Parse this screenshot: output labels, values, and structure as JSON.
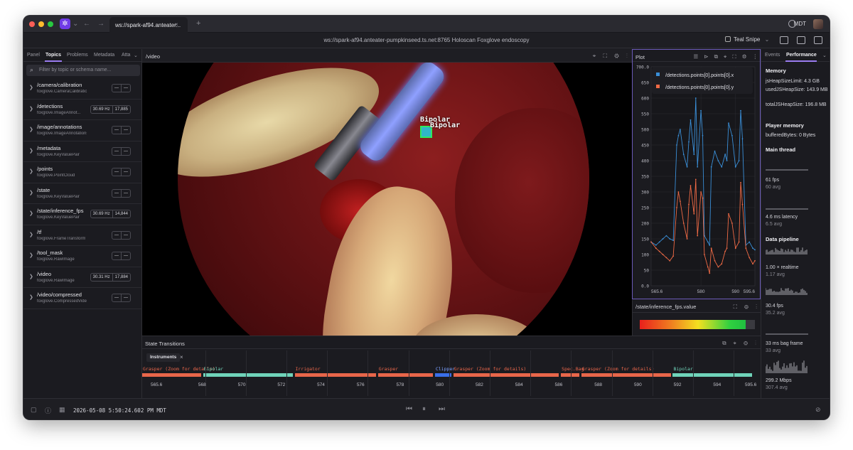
{
  "app": {
    "logo_glyph": "✲",
    "tab_title": "ws://spark-af94.anteater...",
    "tab_close": "×",
    "tab_add": "+",
    "timezone": "MDT",
    "back": "←",
    "forward": "→",
    "chevron": "⌄"
  },
  "toolbar": {
    "connection": "ws://spark-af94.anteater-pumpkinseed.ts.net:8765 Holoscan Foxglove endoscopy",
    "layout_name": "Teal Snipe",
    "layout_chevron": "⌄"
  },
  "left_panel": {
    "tabs": [
      "Panel",
      "Topics",
      "Problems",
      "Metadata",
      "Atta"
    ],
    "active_tab": "Topics",
    "search_placeholder": "Filter by topic or schema name...",
    "search_icon": "⌕",
    "topics": [
      {
        "name": "/camera/calibration",
        "schema": "foxglove.CameraCalibration",
        "hz": "—",
        "count": "—"
      },
      {
        "name": "/detections",
        "schema": "foxglove.ImageAnnot...",
        "hz": "30.69 Hz",
        "count": "17,885"
      },
      {
        "name": "/image/annotations",
        "schema": "foxglove.ImageAnnotations",
        "hz": "—",
        "count": "—"
      },
      {
        "name": "/metadata",
        "schema": "foxglove.KeyValuePair",
        "hz": "—",
        "count": "—"
      },
      {
        "name": "/points",
        "schema": "foxglove.PointCloud",
        "hz": "—",
        "count": "—"
      },
      {
        "name": "/state",
        "schema": "foxglove.KeyValuePair",
        "hz": "—",
        "count": "—"
      },
      {
        "name": "/state/inference_fps",
        "schema": "foxglove.KeyValuePair",
        "hz": "30.69 Hz",
        "count": "14,844"
      },
      {
        "name": "/tf",
        "schema": "foxglove.FrameTransform",
        "hz": "—",
        "count": "—"
      },
      {
        "name": "/tool_mask",
        "schema": "foxglove.RawImage",
        "hz": "—",
        "count": "—"
      },
      {
        "name": "/video",
        "schema": "foxglove.RawImage",
        "hz": "30.31 Hz",
        "count": "17,884"
      },
      {
        "name": "/video/compressed",
        "schema": "foxglove.CompressedVideo",
        "hz": "—",
        "count": "—"
      }
    ]
  },
  "video_panel": {
    "title": "/video",
    "detections": [
      "Bipolar",
      "Bipolar"
    ],
    "icons": "⌖ ⛶ ⚙ ⋮"
  },
  "plot_panel": {
    "title": "Plot",
    "icons": "☰ ⊳ ⧉ ⌖ ⛶ ⚙ ⋮",
    "legend": [
      {
        "label": "/detections.points[0].points[0].x",
        "color": "#3a8fd8"
      },
      {
        "label": "/detections.points[0].points[0].y",
        "color": "#ef6a45"
      }
    ]
  },
  "chart_data": {
    "type": "line",
    "title": "",
    "xlabel": "",
    "ylabel": "",
    "xlim": [
      565.6,
      595.6
    ],
    "ylim": [
      0,
      700
    ],
    "x_ticks": [
      "565.6",
      "580",
      "590",
      "595.6"
    ],
    "y_ticks": [
      "0.0",
      "50",
      "100",
      "150",
      "200",
      "250",
      "300",
      "350",
      "400",
      "450",
      "500",
      "550",
      "600",
      "650",
      "700.0"
    ],
    "grid": true,
    "legend_position": "top",
    "series": [
      {
        "name": "/detections.points[0].points[0].x",
        "color": "#3a8fd8",
        "x": [
          565.6,
          567,
          568,
          569,
          570,
          571,
          572,
          573,
          573.5,
          574,
          575,
          576,
          576.5,
          577,
          578,
          578.5,
          579,
          580,
          580.5,
          581,
          582,
          582.5,
          583,
          584,
          585,
          586,
          587,
          587.5,
          588,
          589,
          590,
          591,
          591.5,
          592,
          593,
          594,
          595,
          595.6
        ],
        "values": [
          140,
          130,
          140,
          150,
          160,
          150,
          145,
          450,
          480,
          500,
          420,
          380,
          460,
          530,
          420,
          600,
          380,
          560,
          480,
          160,
          140,
          130,
          380,
          430,
          400,
          380,
          420,
          400,
          520,
          480,
          380,
          400,
          560,
          470,
          130,
          140,
          120,
          115
        ]
      },
      {
        "name": "/detections.points[0].points[0].y",
        "color": "#ef6a45",
        "x": [
          565.6,
          567,
          568,
          569,
          570,
          571,
          572,
          573,
          573.5,
          574,
          575,
          576,
          576.5,
          577,
          578,
          578.5,
          579,
          580,
          580.5,
          581,
          582,
          582.5,
          583,
          584,
          585,
          586,
          587,
          587.5,
          588,
          589,
          590,
          591,
          591.5,
          592,
          593,
          594,
          595,
          595.6
        ],
        "values": [
          140,
          120,
          110,
          100,
          90,
          80,
          95,
          250,
          300,
          270,
          200,
          150,
          260,
          320,
          230,
          340,
          160,
          300,
          280,
          100,
          60,
          40,
          120,
          80,
          60,
          70,
          110,
          120,
          230,
          200,
          120,
          140,
          330,
          260,
          120,
          90,
          70,
          80
        ]
      }
    ]
  },
  "gauge_panel": {
    "title": "/state/inference_fps.value",
    "value": 0.92,
    "icons": "⛶ ⚙ ⋮"
  },
  "right_panel": {
    "tabs": [
      "Events",
      "Performance"
    ],
    "active_tab": "Performance",
    "memory_heading": "Memory",
    "js_heap_limit": "jsHeapSizeLimit: 4.3 GB",
    "used_heap": "usedJSHeapSize: 143.9 MB",
    "total_heap": "totalJSHeapSize: 196.8 MB",
    "player_memory_heading": "Player memory",
    "buffered_bytes": "bufferedBytes: 0 Bytes",
    "main_thread_heading": "Main thread",
    "fps": "61 fps",
    "fps_avg": "60 avg",
    "latency": "4.6 ms latency",
    "latency_avg": "6.5 avg",
    "pipeline_heading": "Data pipeline",
    "realtime": "1.00 × realtime",
    "realtime_avg": "1.17 avg",
    "pipe_fps": "30.4 fps",
    "pipe_fps_avg": "35.2 avg",
    "bag_frame": "33 ms bag frame",
    "bag_frame_avg": "33 avg",
    "mbps": "299.2 Mbps",
    "mbps_avg": "307.4 avg"
  },
  "state_panel": {
    "title": "State Transitions",
    "icons": "⧉ ⌖ ⚙ ⋮",
    "instruments_tab": "Instruments",
    "close_glyph": "×",
    "segments": [
      {
        "label": "Grasper (Zoom for details)",
        "start": 565.6,
        "end": 568.5,
        "color": "#e8664a",
        "label_color": "#e8664a"
      },
      {
        "label": "Bipolar",
        "start": 568.6,
        "end": 573.0,
        "color": "#6fd3b9",
        "label_color": "#6fd3b9"
      },
      {
        "label": "Irrigator",
        "start": 573.1,
        "end": 577.1,
        "color": "#e8664a",
        "label_color": "#e8664a"
      },
      {
        "label": "Grasper",
        "start": 577.2,
        "end": 579.9,
        "color": "#e8664a",
        "label_color": "#e8664a"
      },
      {
        "label": "Clipper",
        "start": 580.0,
        "end": 580.8,
        "color": "#3a6ee8",
        "label_color": "#7aa0ff"
      },
      {
        "label": "Grasper (Zoom for details)",
        "start": 580.9,
        "end": 586.1,
        "color": "#e8664a",
        "label_color": "#e8664a"
      },
      {
        "label": "Spec.Bag",
        "start": 586.2,
        "end": 587.1,
        "color": "#e8664a",
        "label_color": "#e8664a"
      },
      {
        "label": "Grasper (Zoom for details)",
        "start": 587.2,
        "end": 591.6,
        "color": "#e8664a",
        "label_color": "#e8664a"
      },
      {
        "label": "Bipolar",
        "start": 591.7,
        "end": 595.6,
        "color": "#6fd3b9",
        "label_color": "#6fd3b9"
      }
    ],
    "ticks": [
      "565.6",
      "568",
      "570",
      "572",
      "574",
      "576",
      "578",
      "580",
      "582",
      "584",
      "586",
      "588",
      "590",
      "592",
      "594",
      "595.6"
    ]
  },
  "playback": {
    "timestamp": "2026-05-08 5:50:24.602 PM MDT",
    "prev": "⏮",
    "pause": "⏸",
    "next": "⏭"
  }
}
